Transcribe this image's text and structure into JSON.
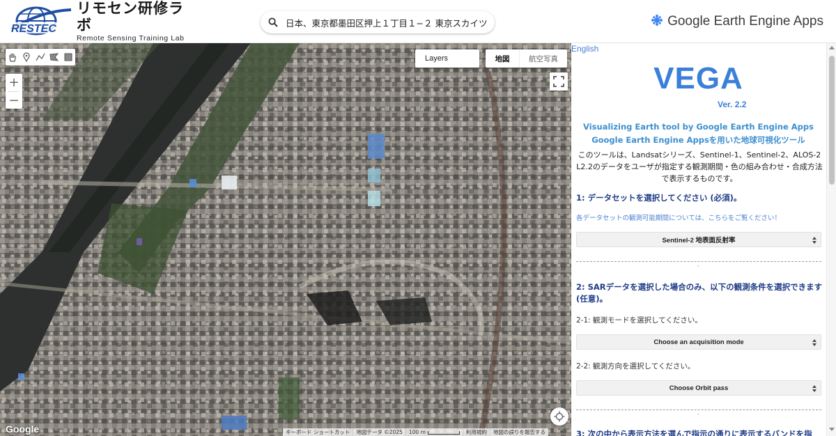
{
  "header": {
    "logo_title": "リモセン研修ラボ",
    "logo_subtitle": "Remote Sensing Training Lab",
    "logo_mark_text": "RESTEC",
    "search_value": "日本、東京都墨田区押上１丁目１−２ 東京スカイツリー",
    "app_title": "Google Earth Engine Apps"
  },
  "map": {
    "layers_label": "Layers",
    "maptype": {
      "map": "地図",
      "satellite": "航空写真",
      "selected": "地図"
    },
    "zoom_in": "+",
    "zoom_out": "−",
    "google_logo": "Google",
    "attribution": {
      "keyboard": "キーボード ショートカット",
      "map_data": "地図データ ©2025",
      "scale": "100 m",
      "terms": "利用規約",
      "report": "地図の誤りを報告する"
    },
    "draw_tools": [
      "hand-icon",
      "marker-icon",
      "polyline-icon",
      "polygon-icon",
      "rectangle-icon"
    ]
  },
  "panel": {
    "language_link": "English",
    "app_name": "VEGA",
    "version": "Ver. 2.2",
    "tagline_en": "Visualizing Earth tool by Google Earth Engine Apps",
    "tagline_jp": "Google Earth Engine Appsを用いた地球可視化ツール",
    "intro": "このツールは、Landsatシリーズ、Sentinel-1、Sentinel-2、ALOS-2 L2.2のデータをユーザが指定する観測期間・色の組み合わせ・合成方法で表示するものです。",
    "section1": {
      "heading": "1: データセットを選択してください (必須)。",
      "link": "各データセットの観測可能期間については、こちらをご覧ください！",
      "select_value": "Sentinel-2 地表面反射率"
    },
    "section2": {
      "heading": "2: SARデータを選択した場合のみ、以下の観測条件を選択できます (任意)。",
      "mode_label": "2-1: 観測モードを選択してください。",
      "mode_select": "Choose an acquisition mode",
      "orbit_label": "2-2: 観測方向を選択してください。",
      "orbit_select": "Choose Orbit pass"
    },
    "section3": {
      "heading": "3: 次の中から表示方法を選んで指示の通りに表示するバンドを指"
    },
    "separator_glyph": "-"
  },
  "colors": {
    "accent_blue": "#3b7fd9",
    "heading_navy": "#1f3c86",
    "link_blue": "#4a7fd4"
  }
}
